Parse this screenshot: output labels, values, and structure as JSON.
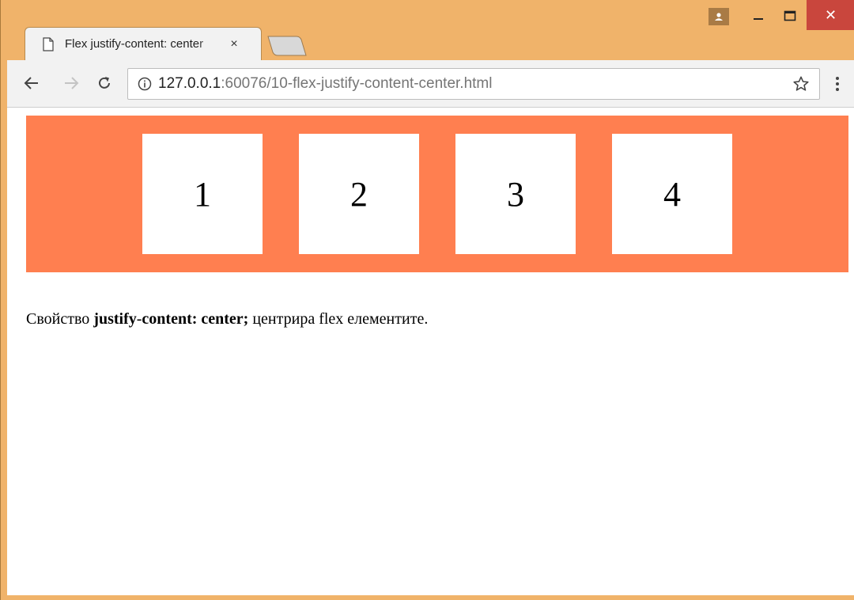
{
  "browser": {
    "tab_title": "Flex justify-content: center",
    "tab_close": "×",
    "url_host": "127.0.0.1",
    "url_rest": ":60076/10-flex-justify-content-center.html",
    "close_glyph": "✕"
  },
  "colors": {
    "frame": "#f0b36a",
    "container": "#ff7f50",
    "item": "#ffffff",
    "close_button": "#c9463d"
  },
  "page": {
    "items": [
      "1",
      "2",
      "3",
      "4"
    ],
    "description": {
      "prefix": "Свойство ",
      "code_part1": "justify",
      "hyphen": "-",
      "code_part2": "content: center;",
      "suffix": " центрира flex елементите."
    }
  },
  "icons": [
    "page-icon",
    "back-arrow-icon",
    "forward-arrow-icon",
    "reload-icon",
    "info-icon",
    "star-icon",
    "menu-dots-icon",
    "user-icon",
    "minimize-icon",
    "maximize-icon",
    "close-icon"
  ]
}
